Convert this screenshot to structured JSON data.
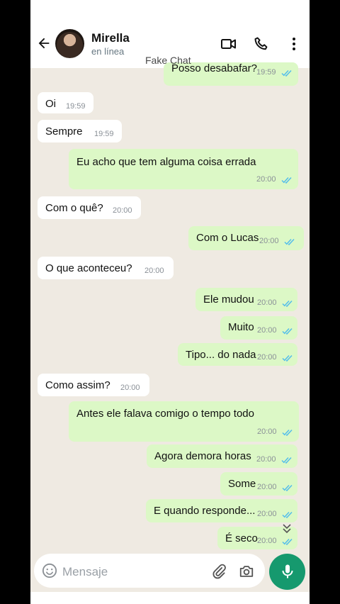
{
  "header": {
    "contact_name": "Mirella",
    "contact_status": "en línea"
  },
  "watermark": "Fake Chat",
  "messages": [
    {
      "dir": "out",
      "text": "Posso desabafar?",
      "time": "19:59"
    },
    {
      "dir": "in",
      "text": "Oi",
      "time": "19:59"
    },
    {
      "dir": "in",
      "text": "Sempre",
      "time": "19:59"
    },
    {
      "dir": "out",
      "text": "Eu acho que tem alguma coisa errada",
      "time": "20:00"
    },
    {
      "dir": "in",
      "text": "Com o quê?",
      "time": "20:00"
    },
    {
      "dir": "out",
      "text": "Com o Lucas",
      "time": "20:00"
    },
    {
      "dir": "in",
      "text": "O que aconteceu?",
      "time": "20:00"
    },
    {
      "dir": "out",
      "text": "Ele mudou",
      "time": "20:00"
    },
    {
      "dir": "out",
      "text": "Muito",
      "time": "20:00"
    },
    {
      "dir": "out",
      "text": "Tipo... do nada",
      "time": "20:00"
    },
    {
      "dir": "in",
      "text": "Como assim?",
      "time": "20:00"
    },
    {
      "dir": "out",
      "text": "Antes ele falava comigo o tempo todo",
      "time": "20:00"
    },
    {
      "dir": "out",
      "text": "Agora demora horas",
      "time": "20:00"
    },
    {
      "dir": "out",
      "text": "Some",
      "time": "20:00"
    },
    {
      "dir": "out",
      "text": "E quando responde...",
      "time": "20:00"
    },
    {
      "dir": "out",
      "text": "É seco",
      "time": "20:00"
    }
  ],
  "composer": {
    "placeholder": "Mensaje"
  },
  "colors": {
    "outgoing_bubble": "#dcf8c6",
    "incoming_bubble": "#ffffff",
    "read_ticks": "#53bdeb",
    "mic_button": "#16996e"
  },
  "icons": [
    "back-arrow-icon",
    "video-call-icon",
    "phone-icon",
    "more-vert-icon",
    "emoji-icon",
    "attach-icon",
    "camera-icon",
    "mic-icon",
    "scroll-down-icon",
    "read-ticks-icon"
  ]
}
